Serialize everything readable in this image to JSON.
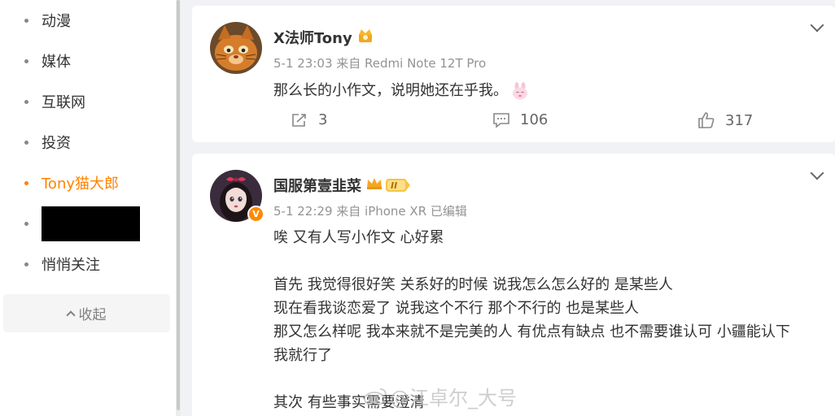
{
  "sidebar": {
    "items": [
      {
        "label": "动漫"
      },
      {
        "label": "媒体"
      },
      {
        "label": "互联网"
      },
      {
        "label": "投资"
      },
      {
        "label": "Tony猫大郎"
      },
      {
        "label": ""
      },
      {
        "label": "悄悄关注"
      }
    ],
    "collapse_label": "收起"
  },
  "posts": [
    {
      "username": "X法师Tony",
      "meta": "5-1 23:03 来自 Redmi Note 12T Pro",
      "content": "那么长的小作文，说明她还在乎我。",
      "emoji_icon": "bunny-emoji-icon",
      "reposts": "3",
      "comments": "106",
      "likes": "317"
    },
    {
      "username": "国服第壹韭菜",
      "level": "II",
      "meta": "5-1 22:29 来自 iPhone XR 已编辑",
      "lines": [
        "唉 又有人写小作文 心好累",
        "",
        "首先 我觉得很好笑 关系好的时候 说我怎么怎么好的 是某些人",
        "现在看我谈恋爱了 说我这个不行 那个不行的 也是某些人",
        "那又怎么样呢 我本来就不是完美的人 有优点有缺点 也不需要谁认可 小疆能认下",
        "我就行了",
        "",
        "其次 有些事实需要澄清"
      ]
    }
  ],
  "watermark": "@江卓尔_大号",
  "colors": {
    "accent": "#ff8200",
    "text": "#333333",
    "meta": "#939393",
    "background": "#f1f2f5"
  }
}
